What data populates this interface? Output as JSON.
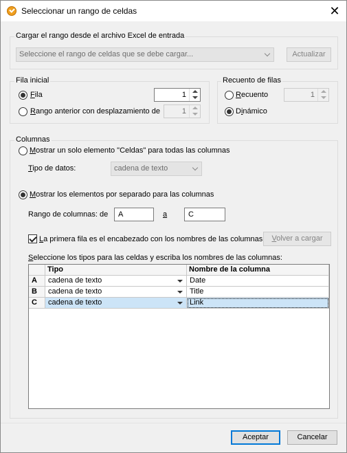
{
  "window": {
    "title": "Seleccionar un rango de celdas",
    "close_glyph": "✕"
  },
  "load_range": {
    "group_title": "Cargar el rango desde el archivo Excel de entrada",
    "select_placeholder": "Seleccione el rango de celdas que se debe cargar...",
    "update_button": "Actualizar"
  },
  "start_row": {
    "group_title": "Fila inicial",
    "row_label": "Fila",
    "row_value": "1",
    "row_checked": true,
    "prev_range_label": "Rango anterior con desplazamiento de",
    "prev_range_value": "1",
    "prev_range_checked": false
  },
  "row_count": {
    "group_title": "Recuento de filas",
    "count_label": "Recuento",
    "count_value": "1",
    "count_checked": false,
    "dynamic_label": "Dinámico",
    "dynamic_checked": true
  },
  "columns": {
    "group_title": "Columnas",
    "single_element_label": "Mostrar un solo elemento \"Celdas\" para todas las columnas",
    "single_element_checked": false,
    "data_type_label": "Tipo de datos:",
    "data_type_value": "cadena de texto",
    "separate_label": "Mostrar los elementos por separado para las columnas",
    "separate_checked": true,
    "col_range_label": "Rango de columnas: de",
    "col_from": "A",
    "col_to_label": "a",
    "col_to": "C",
    "header_row_label": "La primera fila es el encabezado con los nombres de las columnas",
    "header_row_checked": true,
    "reload_button": "Volver a cargar",
    "table_instruction": "Seleccione los tipos para las celdas y escriba los nombres de las columnas:"
  },
  "table": {
    "headers": {
      "type": "Tipo",
      "name": "Nombre de la columna"
    },
    "rows": [
      {
        "key": "A",
        "type": "cadena de texto",
        "name": "Date"
      },
      {
        "key": "B",
        "type": "cadena de texto",
        "name": "Title"
      },
      {
        "key": "C",
        "type": "cadena de texto",
        "name": "Link"
      }
    ]
  },
  "footer": {
    "accept_button": "Aceptar",
    "cancel_button": "Cancelar"
  }
}
